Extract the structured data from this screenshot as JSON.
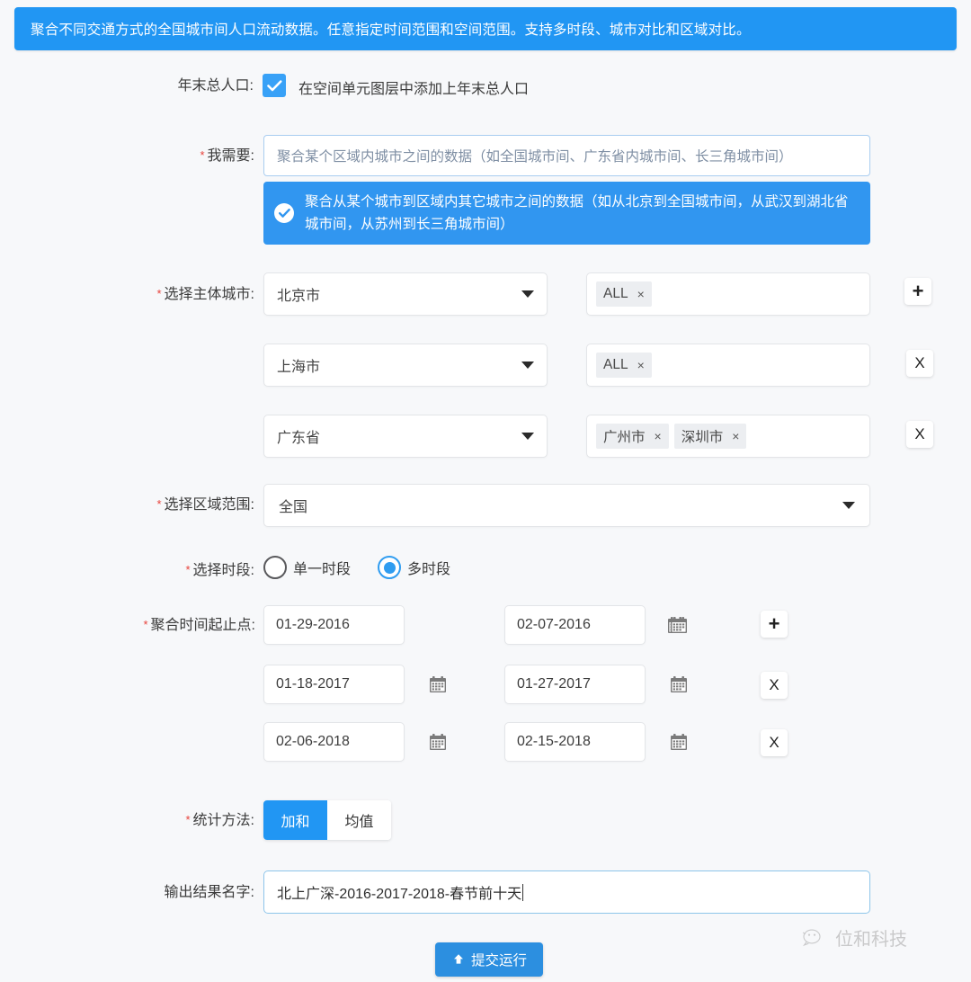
{
  "banner": {
    "text": "聚合不同交通方式的全国城市间人口流动数据。任意指定时间范围和空间范围。支持多时段、城市对比和区域对比。"
  },
  "year_end_population": {
    "label": "年末总人口:",
    "checkbox_icon": "check-icon",
    "checked": true,
    "option_text": "在空间单元图层中添加上年末总人口"
  },
  "need": {
    "label": "我需要:",
    "required": "*",
    "options": [
      {
        "text": "聚合某个区域内城市之间的数据（如全国城市间、广东省内城市间、长三角城市间）",
        "selected": false
      },
      {
        "text": "聚合从某个城市到区域内其它城市之间的数据（如从北京到全国城市间，从武汉到湖北省城市间，从苏州到长三角城市间）",
        "selected": true,
        "icon": "check-circle-icon"
      }
    ]
  },
  "subject_cities": {
    "label": "选择主体城市:",
    "required": "*",
    "rows": [
      {
        "select_value": "北京市",
        "caret_icon": "chevron-down-icon",
        "tags": [
          "ALL"
        ],
        "action_label": "+",
        "action_icon": "plus-icon"
      },
      {
        "select_value": "上海市",
        "caret_icon": "chevron-down-icon",
        "tags": [
          "ALL"
        ],
        "action_label": "X",
        "action_icon": "close-icon"
      },
      {
        "select_value": "广东省",
        "caret_icon": "chevron-down-icon",
        "tags": [
          "广州市",
          "深圳市"
        ],
        "action_label": "X",
        "action_icon": "close-icon"
      }
    ],
    "tag_remove_label": "×"
  },
  "region_scope": {
    "label": "选择区域范围:",
    "required": "*",
    "value": "全国",
    "caret_icon": "chevron-down-icon"
  },
  "period_type": {
    "label": "选择时段:",
    "required": "*",
    "options": [
      {
        "text": "单一时段",
        "selected": false
      },
      {
        "text": "多时段",
        "selected": true
      }
    ]
  },
  "time_ranges": {
    "label": "聚合时间起止点:",
    "required": "*",
    "calendar_icon": "calendar-icon",
    "rows": [
      {
        "start": "01-29-2016",
        "end": "02-07-2016",
        "action_label": "+",
        "action_icon": "plus-icon"
      },
      {
        "start": "01-18-2017",
        "end": "01-27-2017",
        "action_label": "X",
        "action_icon": "close-icon"
      },
      {
        "start": "02-06-2018",
        "end": "02-15-2018",
        "action_label": "X",
        "action_icon": "close-icon"
      }
    ]
  },
  "statistic_method": {
    "label": "统计方法:",
    "required": "*",
    "options": [
      {
        "text": "加和",
        "selected": true
      },
      {
        "text": "均值",
        "selected": false
      }
    ]
  },
  "output_name": {
    "label": "输出结果名字:",
    "value": "北上广深-2016-2017-2018-春节前十天"
  },
  "submit": {
    "label": "提交运行",
    "icon": "upload-icon"
  },
  "watermark": {
    "text": "位和科技",
    "icon": "wechat-logo-icon"
  },
  "colors": {
    "accent": "#2196f3",
    "banner": "#2196f3",
    "selected_option": "#3196f0",
    "required_star": "#e8413a",
    "submit": "#2c8fe0",
    "page_background": "#f7f8fa"
  }
}
